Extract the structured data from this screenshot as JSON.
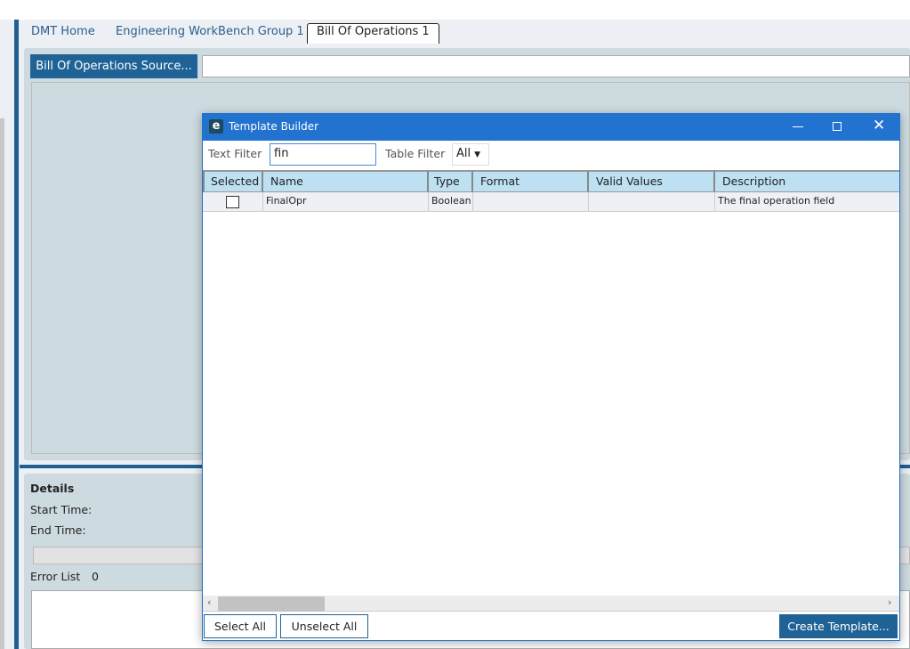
{
  "tabs": [
    {
      "label": "DMT Home"
    },
    {
      "label": "Engineering WorkBench Group 1"
    },
    {
      "label": "Bill Of Operations 1"
    }
  ],
  "source_button": "Bill Of Operations Source...",
  "source_path": "",
  "details": {
    "title": "Details",
    "start_time": "Start Time:",
    "end_time": "End Time:",
    "error_list": "Error List",
    "error_count": "0"
  },
  "dialog": {
    "title": "Template Builder",
    "text_filter_label": "Text Filter",
    "text_filter_value": "fin",
    "table_filter_label": "Table Filter",
    "table_filter_value": "All",
    "columns": [
      "Selected",
      "Name",
      "Type",
      "Format",
      "Valid Values",
      "Description"
    ],
    "rows": [
      {
        "selected": false,
        "name": "FinalOpr",
        "type": "Boolean",
        "format": "",
        "valid_values": "",
        "description": "The final operation field"
      }
    ],
    "select_all": "Select All",
    "unselect_all": "Unselect All",
    "create_template": "Create Template..."
  },
  "colors": {
    "accent": "#1f6396",
    "titlebar": "#2272d0",
    "header": "#bde0f3",
    "panel": "#cddbe0"
  }
}
